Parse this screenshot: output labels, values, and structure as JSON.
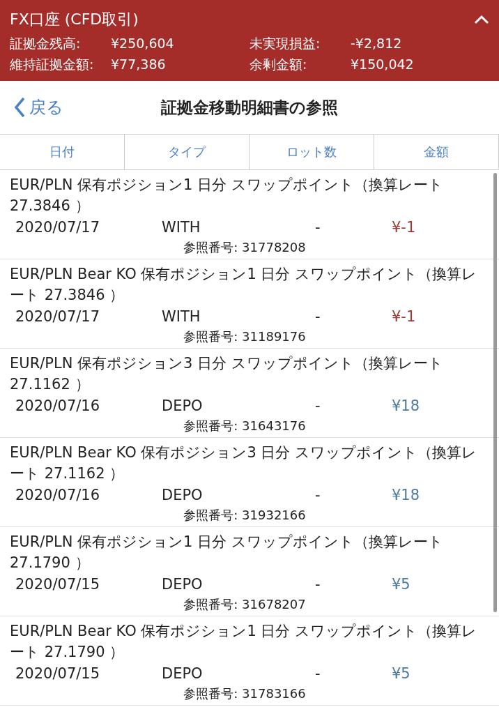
{
  "account": {
    "title": "FX口座 (CFD取引)",
    "summary": [
      {
        "label": "証拠金残高:",
        "value": "¥250,604"
      },
      {
        "label": "未実現損益:",
        "value": "-¥2,812"
      },
      {
        "label": "維持証拠金額:",
        "value": "¥77,386"
      },
      {
        "label": "余剰金額:",
        "value": "¥150,042"
      }
    ]
  },
  "nav": {
    "back": "戻る",
    "title": "証拠金移動明細書の参照"
  },
  "table": {
    "columns": [
      "日付",
      "タイプ",
      "ロット数",
      "金額"
    ],
    "rows": [
      {
        "description": "EUR/PLN 保有ポジション1 日分 スワップポイント（換算レート 27.3846 ）",
        "date": "2020/07/17",
        "type": "WITH",
        "lots": "-",
        "amount": "¥-1",
        "color": "#a33a32",
        "reference": "参照番号: 31778208"
      },
      {
        "description": "EUR/PLN Bear KO 保有ポジション1 日分 スワップポイント（換算レート 27.3846 ）",
        "date": "2020/07/17",
        "type": "WITH",
        "lots": "-",
        "amount": "¥-1",
        "color": "#a33a32",
        "reference": "参照番号: 31189176"
      },
      {
        "description": "EUR/PLN 保有ポジション3 日分 スワップポイント（換算レート 27.1162 ）",
        "date": "2020/07/16",
        "type": "DEPO",
        "lots": "-",
        "amount": "¥18",
        "color": "#4a78a8",
        "reference": "参照番号: 31643176"
      },
      {
        "description": "EUR/PLN Bear KO 保有ポジション3 日分 スワップポイント（換算レート 27.1162 ）",
        "date": "2020/07/16",
        "type": "DEPO",
        "lots": "-",
        "amount": "¥18",
        "color": "#4a78a8",
        "reference": "参照番号: 31932166"
      },
      {
        "description": "EUR/PLN 保有ポジション1 日分 スワップポイント（換算レート 27.1790 ）",
        "date": "2020/07/15",
        "type": "DEPO",
        "lots": "-",
        "amount": "¥5",
        "color": "#4a78a8",
        "reference": "参照番号: 31678207"
      },
      {
        "description": "EUR/PLN Bear KO 保有ポジション1 日分 スワップポイント（換算レート 27.1790 ）",
        "date": "2020/07/15",
        "type": "DEPO",
        "lots": "-",
        "amount": "¥5",
        "color": "#4a78a8",
        "reference": "参照番号: 31783166"
      }
    ]
  }
}
